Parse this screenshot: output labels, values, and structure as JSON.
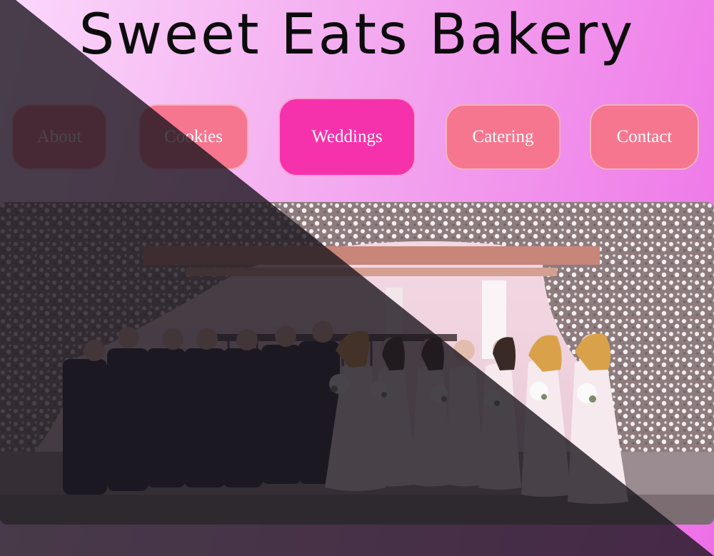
{
  "site": {
    "title": "Sweet Eats Bakery"
  },
  "nav": {
    "items": [
      {
        "label": "About"
      },
      {
        "label": "Cookies"
      },
      {
        "label": "Weddings",
        "active": true
      },
      {
        "label": "Catering"
      },
      {
        "label": "Contact"
      }
    ]
  },
  "hero": {
    "image_subject": "wedding-party-photo"
  },
  "colors": {
    "background_gradient": [
      "#fbd8fb",
      "#f3a9ef",
      "#ee6fe7"
    ],
    "nav_button": "#f6768f",
    "nav_button_active": "#f532ac",
    "overlay": "#1c161e"
  }
}
